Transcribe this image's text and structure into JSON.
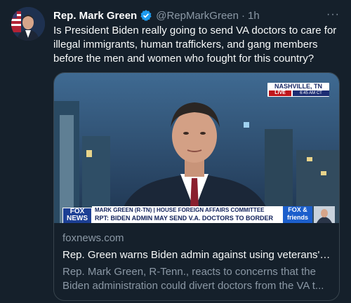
{
  "tweet": {
    "author_name": "Rep. Mark Green",
    "handle": "@RepMarkGreen",
    "separator": "·",
    "time": "1h",
    "more": "···",
    "text": "Is President Biden really going to send VA doctors to care for illegal immigrants, human traffickers, and gang members before the men and women who fought for this country?"
  },
  "card": {
    "domain": "foxnews.com",
    "title": "Rep. Green warns Biden admin against using veterans' ...",
    "description": "Rep. Mark Green, R-Tenn., reacts to concerns that the Biden administration could divert doctors from the VA t..."
  },
  "broadcast": {
    "location": "NASHVILLE, TN",
    "live": "LIVE",
    "time": "6:45 AM CT",
    "network_logo": "FOX NEWS",
    "chyron_top": "MARK GREEN (R-TN) | HOUSE FOREIGN AFFAIRS COMMITTEE",
    "chyron_bottom": "RPT: BIDEN ADMIN MAY SEND V.A. DOCTORS TO BORDER",
    "show_logo": "FOX & friends"
  },
  "colors": {
    "background": "#15202b",
    "verified": "#1d9bf0",
    "muted_text": "#8b98a5",
    "card_border": "#38444d"
  },
  "icons": {
    "verified": "verified-badge-icon",
    "more": "more-options-icon"
  }
}
